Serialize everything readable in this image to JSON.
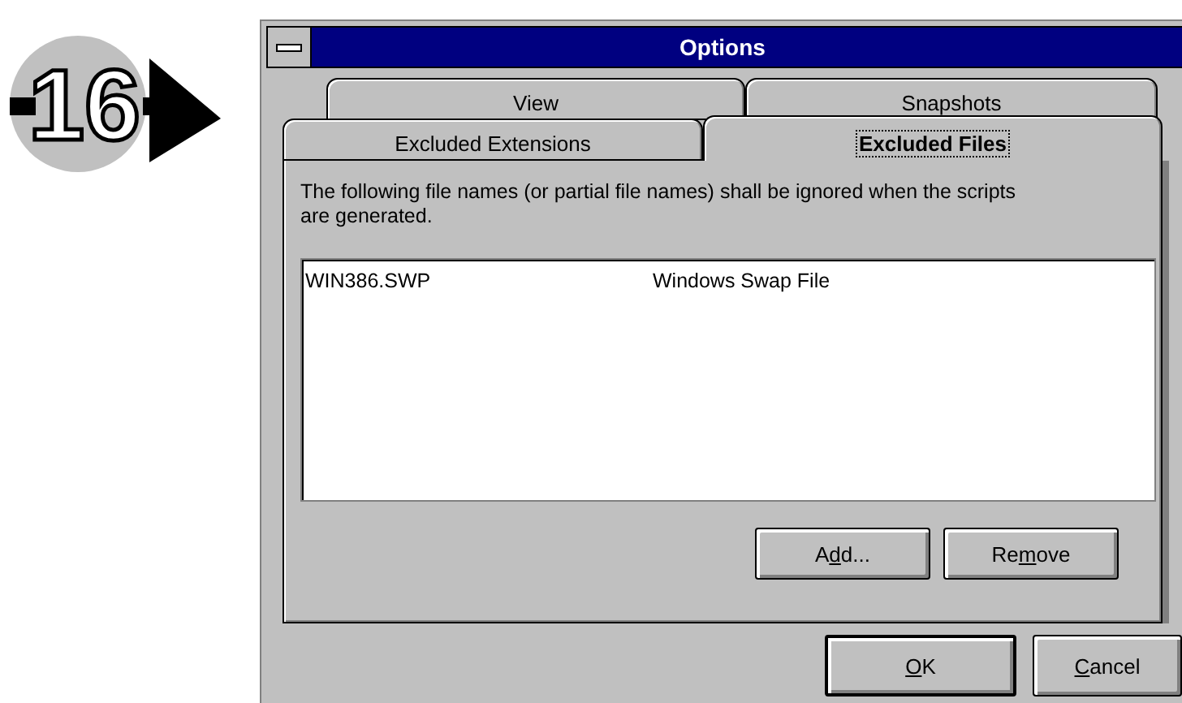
{
  "step_badge": {
    "number": "16"
  },
  "window": {
    "title": "Options"
  },
  "tab_rows": [
    {
      "tabs": [
        {
          "label": "View",
          "selected": false
        },
        {
          "label": "Snapshots",
          "selected": false
        }
      ]
    },
    {
      "tabs": [
        {
          "label": "Excluded Extensions",
          "selected": false
        },
        {
          "label": "Excluded Files",
          "selected": true
        }
      ]
    }
  ],
  "description": "The following file names (or partial file names) shall be ignored when the scripts are generated.",
  "file_list": {
    "rows": [
      {
        "name": "WIN386.SWP",
        "description": "Windows Swap File",
        "selected": false
      }
    ]
  },
  "panel_buttons": [
    {
      "label": {
        "before": "A",
        "key": "d",
        "after": "d..."
      }
    },
    {
      "label": {
        "before": "Re",
        "key": "m",
        "after": "ove"
      }
    }
  ],
  "dialog_buttons": [
    {
      "label": {
        "key": "O",
        "after": "K"
      },
      "default": true
    },
    {
      "label": {
        "key": "C",
        "after": "ancel"
      },
      "default": false
    }
  ]
}
